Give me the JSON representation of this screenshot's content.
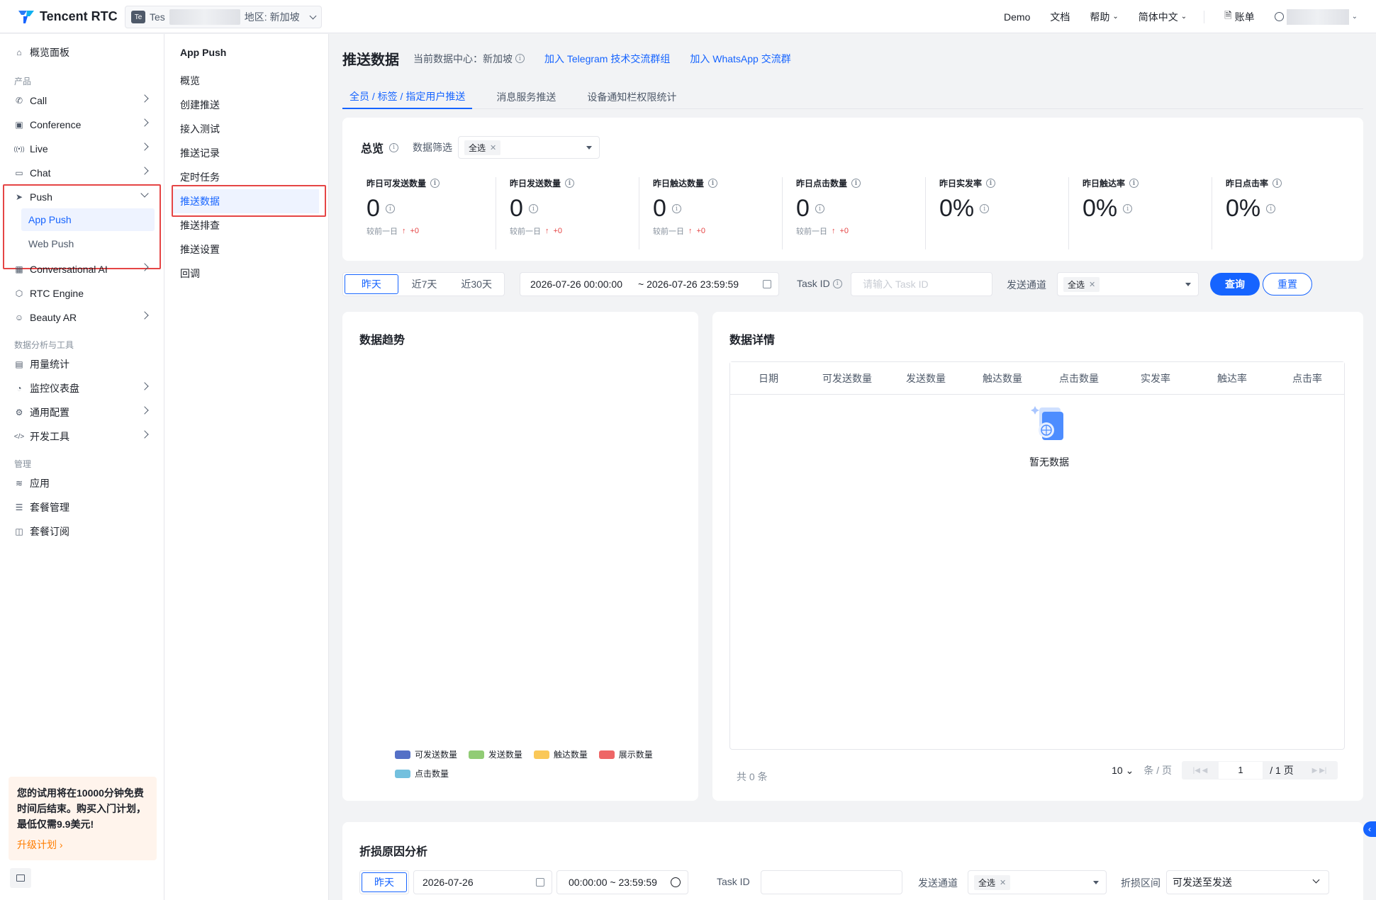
{
  "topbar": {
    "brand": "Tencent RTC",
    "app_badge": "Te",
    "app_prefix": "Tes",
    "region": "地区: 新加坡",
    "links": [
      "Demo",
      "文档",
      "帮助",
      "简体中文"
    ],
    "billing": "账单"
  },
  "leftnav": {
    "overview": "概览面板",
    "group_product": "产品",
    "products": [
      "Call",
      "Conference",
      "Live",
      "Chat",
      "Push"
    ],
    "push_children": [
      "App Push",
      "Web Push"
    ],
    "products2": [
      "Conversational AI",
      "RTC Engine",
      "Beauty AR"
    ],
    "group_tools": "数据分析与工具",
    "tools": [
      "用量统计",
      "监控仪表盘",
      "通用配置",
      "开发工具"
    ],
    "group_manage": "管理",
    "manage": [
      "应用",
      "套餐管理",
      "套餐订阅"
    ],
    "promo_text": "您的试用将在10000分钟免费时间后结束。购买入门计划，最低仅需9.9美元!",
    "promo_link": "升级计划"
  },
  "subnav": {
    "title": "App Push",
    "items": [
      "概览",
      "创建推送",
      "接入测试",
      "推送记录",
      "定时任务",
      "推送数据",
      "推送排查",
      "推送设置",
      "回调"
    ]
  },
  "page": {
    "title": "推送数据",
    "datacenter": "当前数据中心：新加坡",
    "link_telegram": "加入 Telegram 技术交流群组",
    "link_whatsapp": "加入 WhatsApp 交流群",
    "tabs": [
      "全员 / 标签 / 指定用户推送",
      "消息服务推送",
      "设备通知栏权限统计"
    ]
  },
  "overview": {
    "title": "总览",
    "filter_label": "数据筛选",
    "filter_value": "全选",
    "compare_label": "较前一日",
    "stats": [
      {
        "label": "昨日可发送数量",
        "value": "0",
        "delta": "+0"
      },
      {
        "label": "昨日发送数量",
        "value": "0",
        "delta": "+0"
      },
      {
        "label": "昨日触达数量",
        "value": "0",
        "delta": "+0"
      },
      {
        "label": "昨日点击数量",
        "value": "0",
        "delta": "+0"
      },
      {
        "label": "昨日实发率",
        "value": "0%"
      },
      {
        "label": "昨日触达率",
        "value": "0%"
      },
      {
        "label": "昨日点击率",
        "value": "0%"
      }
    ]
  },
  "filters": {
    "ranges": [
      "昨天",
      "近7天",
      "近30天"
    ],
    "start": "2026-07-26 00:00:00",
    "end": "~ 2026-07-26 23:59:59",
    "taskid_label": "Task ID",
    "taskid_placeholder": "请输入 Task ID",
    "channel_label": "发送通道",
    "channel_value": "全选",
    "query": "查询",
    "reset": "重置"
  },
  "trend": {
    "title": "数据趋势",
    "legend": [
      {
        "name": "可发送数量",
        "color": "#5470c6"
      },
      {
        "name": "发送数量",
        "color": "#91cc75"
      },
      {
        "name": "触达数量",
        "color": "#fac858"
      },
      {
        "name": "展示数量",
        "color": "#ee6666"
      },
      {
        "name": "点击数量",
        "color": "#73c0de"
      }
    ]
  },
  "detail": {
    "title": "数据详情",
    "columns": [
      "日期",
      "可发送数量",
      "发送数量",
      "触达数量",
      "点击数量",
      "实发率",
      "触达率",
      "点击率"
    ],
    "empty": "暂无数据",
    "total": "共 0 条",
    "page_size": "10",
    "page_size_unit": "条 / 页",
    "page": "1",
    "pages": "/ 1 页"
  },
  "loss": {
    "title": "折损原因分析",
    "range": "昨天",
    "date": "2026-07-26",
    "time": "00:00:00 ~ 23:59:59",
    "taskid_label": "Task ID",
    "channel_label": "发送通道",
    "channel_value": "全选",
    "interval_label": "折损区间",
    "interval_value": "可发送至发送"
  }
}
